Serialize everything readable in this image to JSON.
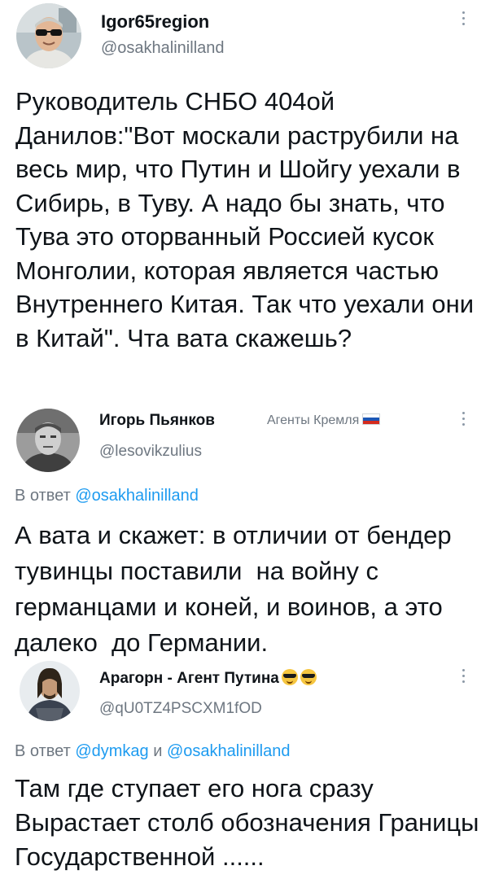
{
  "posts": [
    {
      "author": "Igor65region",
      "handle": "@osakhalinilland",
      "text": "Руководитель СНБО 404ой Данилов:\"Вот москали раструбили на весь мир, что Путин и Шойгу уехали в Сибирь, в Туву. А надо бы знать, что Тува это оторванный Россией кусок Монголии, которая является частью Внутреннего Китая. Так что уехали они в Китай\". Чта вата скажешь?"
    },
    {
      "author": "Игорь Пьянков",
      "handle": "@lesovikzulius",
      "badge": "Агенты Кремля",
      "reply_prefix": "В ответ",
      "reply_mention": "@osakhalinilland",
      "text": "А вата и скажет: в отличии от бендер тувинцы поставили  на войну с германцами и коней, и воинов, а это далеко  до Германии."
    },
    {
      "author": "Арагорн - Агент Путина",
      "handle": "@qU0TZ4PSCXM1fOD",
      "reply_prefix": "В ответ",
      "reply_mention_1": "@dymkag",
      "reply_and": "и",
      "reply_mention_2": "@osakhalinilland",
      "text": "Там где ступает его нога сразу Вырастает столб обозначения Границы Государственной ......"
    }
  ],
  "icons": {
    "more": "vertical-ellipsis-icon",
    "flag": "russian-flag-icon",
    "emoji": "sunglasses-face-emoji"
  },
  "colors": {
    "text": "#0f1419",
    "secondary": "#6e7781",
    "mention": "#1d9bf0"
  }
}
